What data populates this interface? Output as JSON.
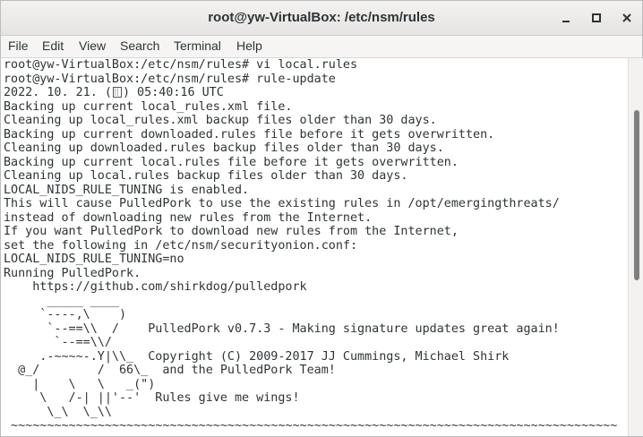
{
  "window": {
    "title": "root@yw-VirtualBox: /etc/nsm/rules",
    "controls": {
      "minimize": "minimize-icon",
      "maximize": "maximize-icon",
      "close": "close-icon"
    }
  },
  "menubar": {
    "items": [
      "File",
      "Edit",
      "View",
      "Search",
      "Terminal",
      "Help"
    ]
  },
  "terminal": {
    "lines": [
      "root@yw-VirtualBox:/etc/nsm/rules# vi local.rules",
      "root@yw-VirtualBox:/etc/nsm/rules# rule-update",
      "2022. 10. 21. (",
      "Backing up current local_rules.xml file.",
      "Cleaning up local_rules.xml backup files older than 30 days.",
      "Backing up current downloaded.rules file before it gets overwritten.",
      "Cleaning up downloaded.rules backup files older than 30 days.",
      "Backing up current local.rules file before it gets overwritten.",
      "Cleaning up local.rules backup files older than 30 days.",
      "LOCAL_NIDS_RULE_TUNING is enabled.",
      "This will cause PulledPork to use the existing rules in /opt/emergingthreats/",
      "instead of downloading new rules from the Internet.",
      "If you want PulledPork to download new rules from the Internet,",
      "set the following in /etc/nsm/securityonion.conf:",
      "LOCAL_NIDS_RULE_TUNING=no",
      "Running PulledPork.",
      "    https://github.com/shirkdog/pulledpork",
      "      _____ ____",
      "     `----,\\    )",
      "      `--==\\\\  /    PulledPork v0.7.3 - Making signature updates great again!",
      "       `--==\\\\/",
      "     .-~~~~-.Y|\\\\_  Copyright (C) 2009-2017 JJ Cummings, Michael Shirk",
      "  @_/        /  66\\_  and the PulledPork Team!",
      "    |    \\   \\   _(\")",
      "     \\   /-| ||'--'  Rules give me wings!",
      "      \\_\\  \\_\\\\",
      " ~~~~~~~~~~~~~~~~~~~~~~~~~~~~~~~~~~~~~~~~~~~~~~~~~~~~~~~~~~~~~~~~~~~~~~~~~~~~~~~~~~~~"
    ],
    "date_suffix": ") 05:40:16 UTC",
    "date_glyph": "box-glyph"
  },
  "scrollbar": {
    "position": 0.25,
    "visible_fraction": 0.45
  }
}
